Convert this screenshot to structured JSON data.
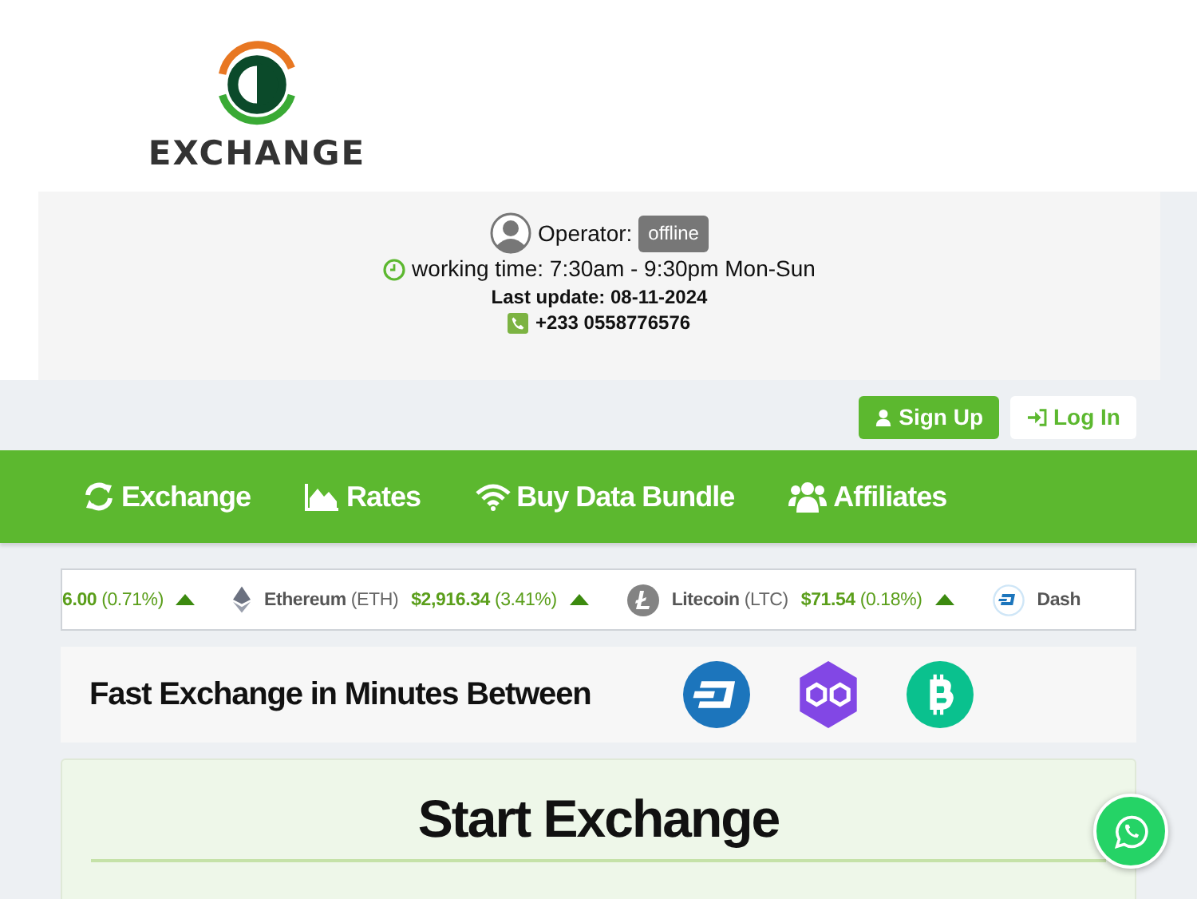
{
  "logo": {
    "text": "EXCHANGE"
  },
  "info": {
    "operator_label": "Operator:",
    "operator_status": "offline",
    "working_time": "working time: 7:30am - 9:30pm Mon-Sun",
    "last_update": "Last update: 08-11-2024",
    "phone": "+233 0558776576"
  },
  "auth": [
    {
      "label": "Sign Up",
      "kind": "signup"
    },
    {
      "label": "Log In",
      "kind": "login"
    }
  ],
  "nav": [
    {
      "label": "Exchange"
    },
    {
      "label": "Rates"
    },
    {
      "label": "Buy Data Bundle"
    },
    {
      "label": "Affiliates"
    }
  ],
  "ticker": [
    {
      "kind": "partial",
      "price": "6.00",
      "change": "(0.71%)",
      "up": true
    },
    {
      "kind": "ethereum",
      "name": "Ethereum",
      "symbol": "(ETH)",
      "price": "$2,916.34",
      "change": "(3.41%)",
      "up": true
    },
    {
      "kind": "litecoin",
      "name": "Litecoin",
      "symbol": "(LTC)",
      "price": "$71.54",
      "change": "(0.18%)",
      "up": true
    },
    {
      "kind": "dash",
      "name": "Dash"
    }
  ],
  "fast": {
    "title": "Fast Exchange in Minutes Between",
    "coins": [
      {
        "kind": "dash"
      },
      {
        "kind": "polygon"
      },
      {
        "kind": "bitcoincash"
      }
    ]
  },
  "start": {
    "title": "Start Exchange"
  }
}
